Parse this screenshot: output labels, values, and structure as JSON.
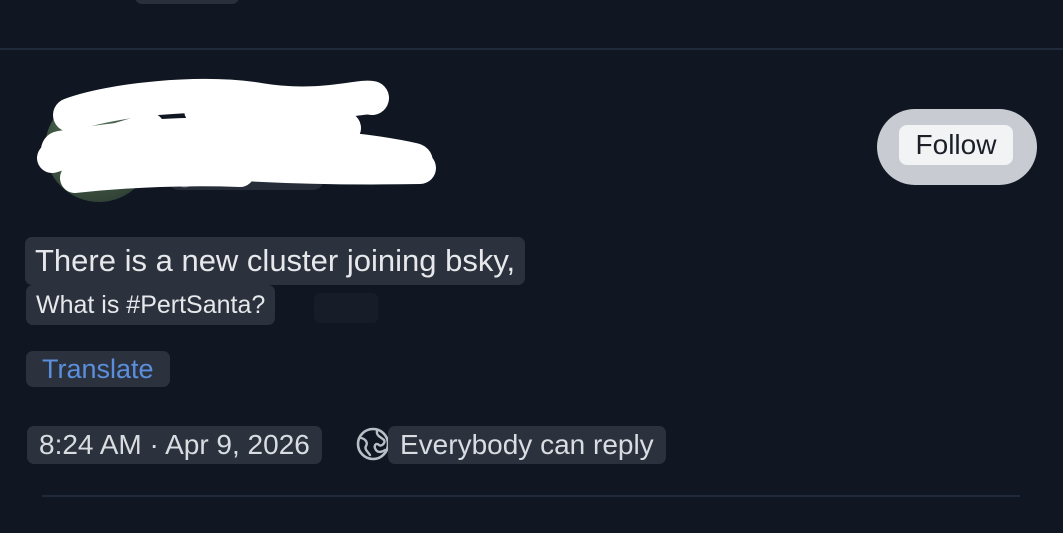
{
  "post": {
    "author_handle_partial": "@",
    "follow_label": "Follow",
    "text_line_1": "There is a new cluster joining bsky,",
    "text_line_2": "What is #PertSanta?",
    "translate_label": "Translate",
    "time": "8:24 AM",
    "separator": "·",
    "date": "Apr 9, 2026",
    "reply_setting": "Everybody can reply"
  },
  "icons": {
    "reply_setting_icon": "globe-icon"
  },
  "colors": {
    "background": "#111722",
    "follow_button": "#c8ccd2",
    "link": "#5b8fdc",
    "text": "#e6e8eb"
  }
}
